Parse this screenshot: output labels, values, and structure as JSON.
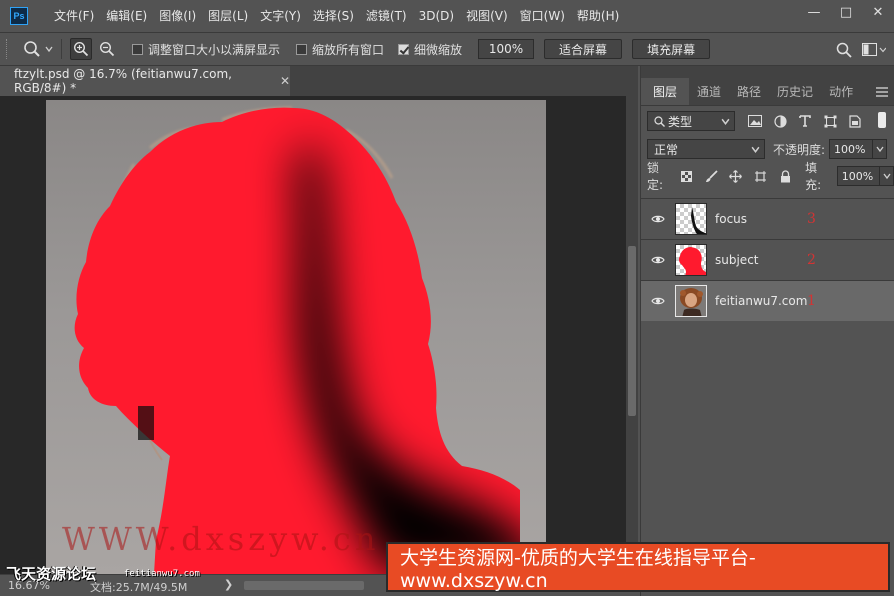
{
  "app": {
    "logo": "Ps"
  },
  "menu": [
    "文件(F)",
    "编辑(E)",
    "图像(I)",
    "图层(L)",
    "文字(Y)",
    "选择(S)",
    "滤镜(T)",
    "3D(D)",
    "视图(V)",
    "窗口(W)",
    "帮助(H)"
  ],
  "window_controls": {
    "minimize": "—",
    "maximize": "□",
    "close": "✕"
  },
  "options": {
    "resize_windows_label": "调整窗口大小以满屏显示",
    "resize_windows_checked": false,
    "zoom_all_label": "缩放所有窗口",
    "zoom_all_checked": false,
    "scrubby_label": "细微缩放",
    "scrubby_checked": true,
    "zoom_value": "100%",
    "fit_screen": "适合屏幕",
    "fill_screen": "填充屏幕"
  },
  "document": {
    "tab_title": "ftzylt.psd @ 16.7% (feitianwu7.com, RGB/8#) *",
    "close": "✕"
  },
  "status": {
    "zoom": "16.67%",
    "doc_size": "文档:25.7M/49.5M",
    "arrow": "❯"
  },
  "panel": {
    "tabs": [
      "图层",
      "通道",
      "路径",
      "历史记",
      "动作"
    ],
    "active_tab": 0,
    "filter_kind": "类型",
    "blend_mode": "正常",
    "opacity_label": "不透明度:",
    "opacity_value": "100%",
    "lock_label": "锁定:",
    "fill_label": "填充:",
    "fill_value": "100%"
  },
  "layers": [
    {
      "name": "focus",
      "annotation": "3",
      "thumb": "focus",
      "selected": false
    },
    {
      "name": "subject",
      "annotation": "2",
      "thumb": "subject",
      "selected": false
    },
    {
      "name": "feitianwu7.com",
      "annotation": "1",
      "thumb": "photo",
      "selected": true
    }
  ],
  "watermarks": {
    "banner": "大学生资源网-优质的大学生在线指导平台-www.dxszyw.cn",
    "left": "飞天资源论坛",
    "site": "feitianwu7.com",
    "red": "WWW.dxszyw.cn"
  },
  "colors": {
    "ui_bg": "#535353",
    "canvas_bg": "#282828",
    "mask_red": "#ff1a2e",
    "banner": "#e84b24",
    "annotation": "#d13434"
  }
}
